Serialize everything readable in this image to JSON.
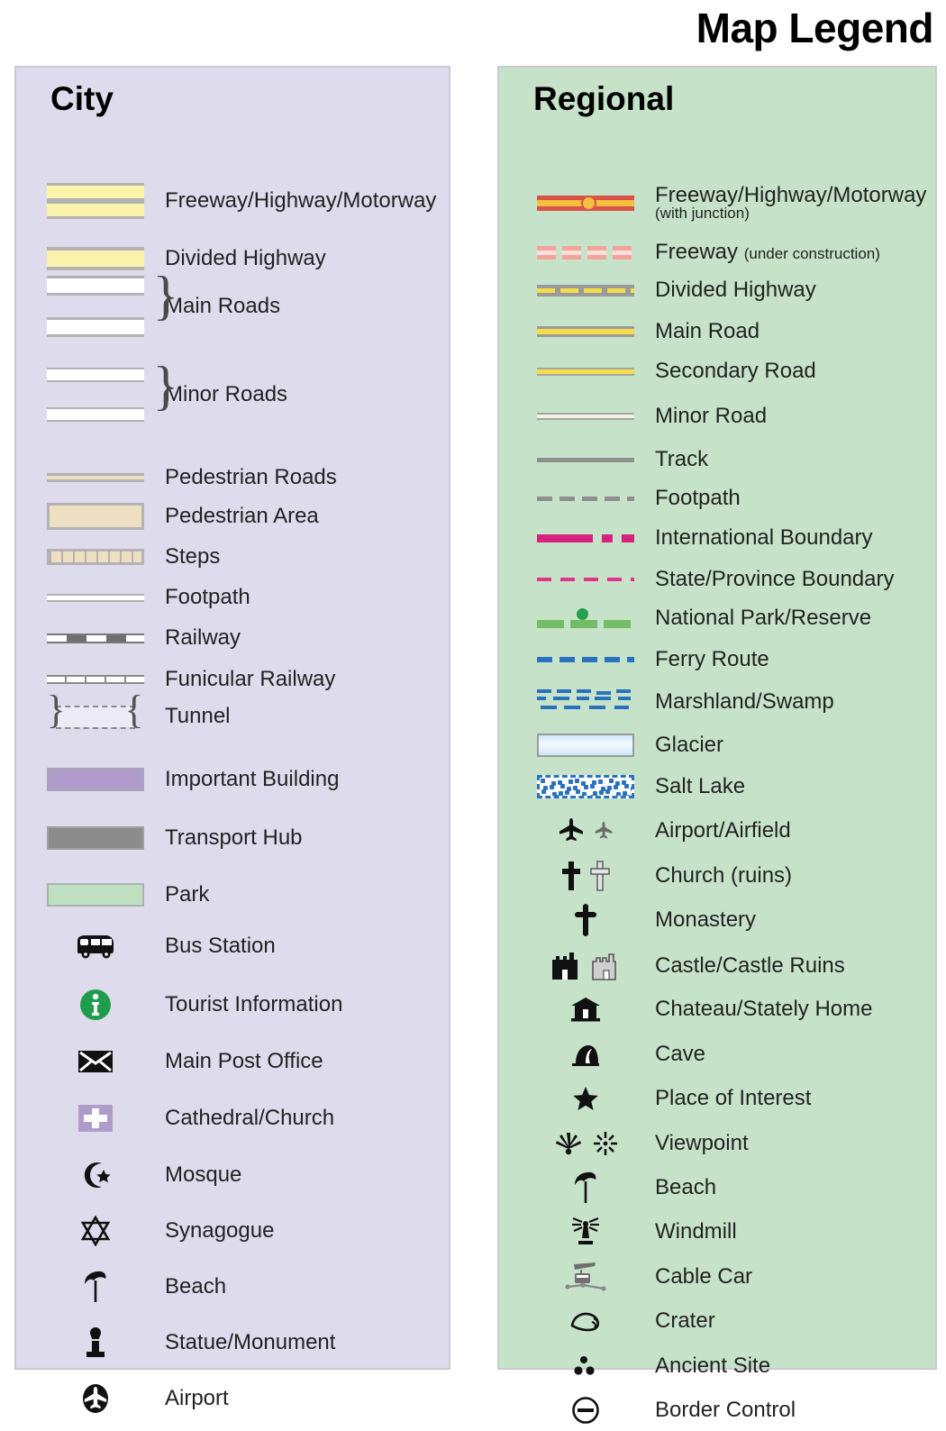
{
  "title": "Map Legend",
  "panels": {
    "city": {
      "heading": "City",
      "background_color": "#dedcec",
      "items": [
        {
          "label": "Freeway/Highway/Motorway",
          "symbol": "city-freeway"
        },
        {
          "label": "Divided Highway",
          "symbol": "city-divided-highway"
        },
        {
          "label": "Main Roads",
          "symbol": "city-main-roads-braced"
        },
        {
          "label": "Minor Roads",
          "symbol": "city-minor-roads-braced"
        },
        {
          "label": "Pedestrian Roads",
          "symbol": "city-pedestrian-road"
        },
        {
          "label": "Pedestrian Area",
          "symbol": "city-pedestrian-area"
        },
        {
          "label": "Steps",
          "symbol": "city-steps"
        },
        {
          "label": "Footpath",
          "symbol": "city-footpath"
        },
        {
          "label": "Railway",
          "symbol": "city-railway"
        },
        {
          "label": "Funicular Railway",
          "symbol": "city-funicular-railway"
        },
        {
          "label": "Tunnel",
          "symbol": "city-tunnel"
        },
        {
          "label": "Important Building",
          "symbol": "city-important-building"
        },
        {
          "label": "Transport Hub",
          "symbol": "city-transport-hub"
        },
        {
          "label": "Park",
          "symbol": "city-park"
        },
        {
          "label": "Bus Station",
          "symbol": "bus-icon"
        },
        {
          "label": "Tourist Information",
          "symbol": "information-icon"
        },
        {
          "label": "Main Post Office",
          "symbol": "envelope-icon"
        },
        {
          "label": "Cathedral/Church",
          "symbol": "church-cross-block-icon"
        },
        {
          "label": "Mosque",
          "symbol": "star-and-crescent-icon"
        },
        {
          "label": "Synagogue",
          "symbol": "star-of-david-icon"
        },
        {
          "label": "Beach",
          "symbol": "beach-umbrella-icon"
        },
        {
          "label": "Statue/Monument",
          "symbol": "monument-icon"
        },
        {
          "label": "Airport",
          "symbol": "airport-circle-icon"
        }
      ]
    },
    "regional": {
      "heading": "Regional",
      "background_color": "#c6e3ca",
      "items": [
        {
          "label": "Freeway/Highway/Motorway",
          "sublabel": "(with junction)",
          "sublabel_position": "below",
          "symbol": "regional-freeway-junction"
        },
        {
          "label": "Freeway",
          "sublabel": "(under construction)",
          "sublabel_position": "inline",
          "symbol": "regional-freeway-under-construction"
        },
        {
          "label": "Divided Highway",
          "symbol": "regional-divided-highway"
        },
        {
          "label": "Main Road",
          "symbol": "regional-main-road"
        },
        {
          "label": "Secondary Road",
          "symbol": "regional-secondary-road"
        },
        {
          "label": "Minor Road",
          "symbol": "regional-minor-road"
        },
        {
          "label": "Track",
          "symbol": "regional-track"
        },
        {
          "label": "Footpath",
          "symbol": "regional-footpath"
        },
        {
          "label": "International Boundary",
          "symbol": "regional-international-boundary"
        },
        {
          "label": "State/Province Boundary",
          "symbol": "regional-state-boundary"
        },
        {
          "label": "National Park/Reserve",
          "symbol": "regional-national-park"
        },
        {
          "label": "Ferry Route",
          "symbol": "regional-ferry-route"
        },
        {
          "label": "Marshland/Swamp",
          "symbol": "regional-marshland"
        },
        {
          "label": "Glacier",
          "symbol": "regional-glacier"
        },
        {
          "label": "Salt Lake",
          "symbol": "regional-salt-lake"
        },
        {
          "label": "Airport/Airfield",
          "symbol": "airplane-pair-icon"
        },
        {
          "label": "Church (ruins)",
          "symbol": "cross-pair-icon"
        },
        {
          "label": "Monastery",
          "symbol": "monastery-cross-icon"
        },
        {
          "label": "Castle/Castle Ruins",
          "symbol": "castle-pair-icon"
        },
        {
          "label": "Chateau/Stately Home",
          "symbol": "chateau-icon"
        },
        {
          "label": "Cave",
          "symbol": "cave-icon"
        },
        {
          "label": "Place of Interest",
          "symbol": "star-icon"
        },
        {
          "label": "Viewpoint",
          "symbol": "viewpoint-pair-icon"
        },
        {
          "label": "Beach",
          "symbol": "beach-umbrella-icon"
        },
        {
          "label": "Windmill",
          "symbol": "windmill-icon"
        },
        {
          "label": "Cable Car",
          "symbol": "cable-car-icon"
        },
        {
          "label": "Crater",
          "symbol": "crater-icon"
        },
        {
          "label": "Ancient Site",
          "symbol": "ancient-site-icon"
        },
        {
          "label": "Border Control",
          "symbol": "border-control-icon"
        }
      ]
    }
  },
  "colors": {
    "city_panel": "#dedcec",
    "regional_panel": "#c6e3ca",
    "highway_yellow": "#fbf3ab",
    "regional_road_yellow": "#f5dc4a",
    "freeway_red": "#d8524a",
    "freeway_core": "#f5c03e",
    "boundary_magenta": "#d6247e",
    "park_green": "#73bd66",
    "ferry_blue": "#2a72bd",
    "important_building": "#b09ccc",
    "transport_hub": "#8c8c8c",
    "park_fill": "#bfe0c0",
    "pedestrian_tan": "#efdfc2",
    "info_green": "#1f9d4d"
  }
}
